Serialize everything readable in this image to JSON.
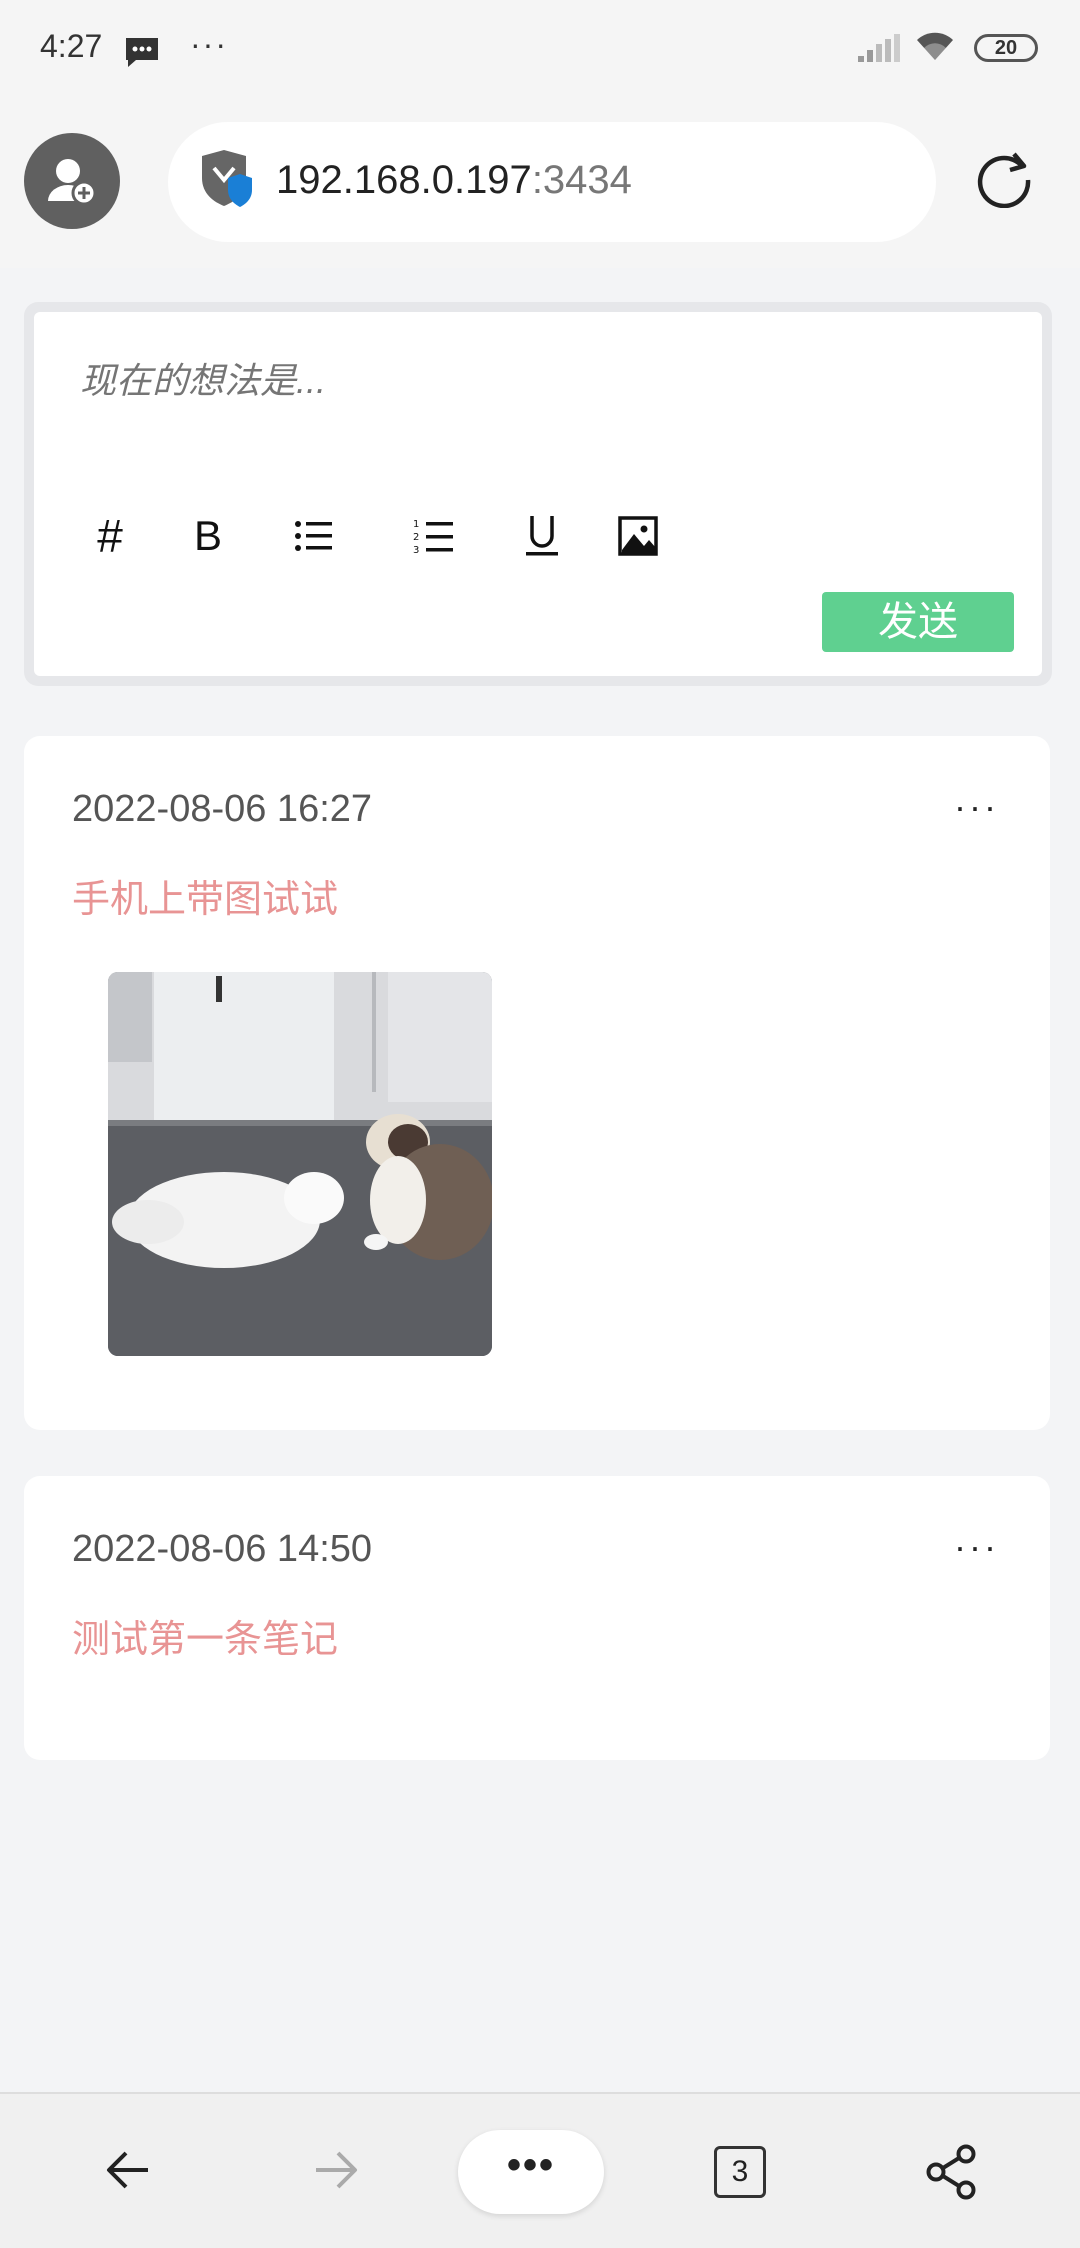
{
  "status_bar": {
    "time": "4:27",
    "icons": [
      "message-icon",
      "more-dots-icon",
      "signal-icon",
      "wifi-icon",
      "battery-icon"
    ],
    "more": "···",
    "battery": "20"
  },
  "browser": {
    "url_host": "192.168.0.197",
    "url_port": ":3434",
    "icons": [
      "avatar-add-icon",
      "security-shield-icon",
      "refresh-icon"
    ]
  },
  "composer": {
    "placeholder": "现在的想法是...",
    "tools": {
      "hash": "#",
      "bold": "B",
      "icons": [
        "bullet-list-icon",
        "numbered-list-icon",
        "underline-icon",
        "image-icon"
      ]
    },
    "send_label": "发送",
    "send_color": "#5fd090"
  },
  "notes": [
    {
      "time": "2022-08-06 16:27",
      "text": "手机上带图试试",
      "more": "···"
    },
    {
      "time": "2022-08-06 14:50",
      "text": "测试第一条笔记",
      "more": "···"
    }
  ],
  "note_text_color": "#e89494",
  "bottom_nav": {
    "menu": "•••",
    "tab_count": "3",
    "icons": [
      "back-arrow-icon",
      "forward-arrow-icon",
      "menu-dots-icon",
      "tabs-icon",
      "share-icon"
    ]
  }
}
